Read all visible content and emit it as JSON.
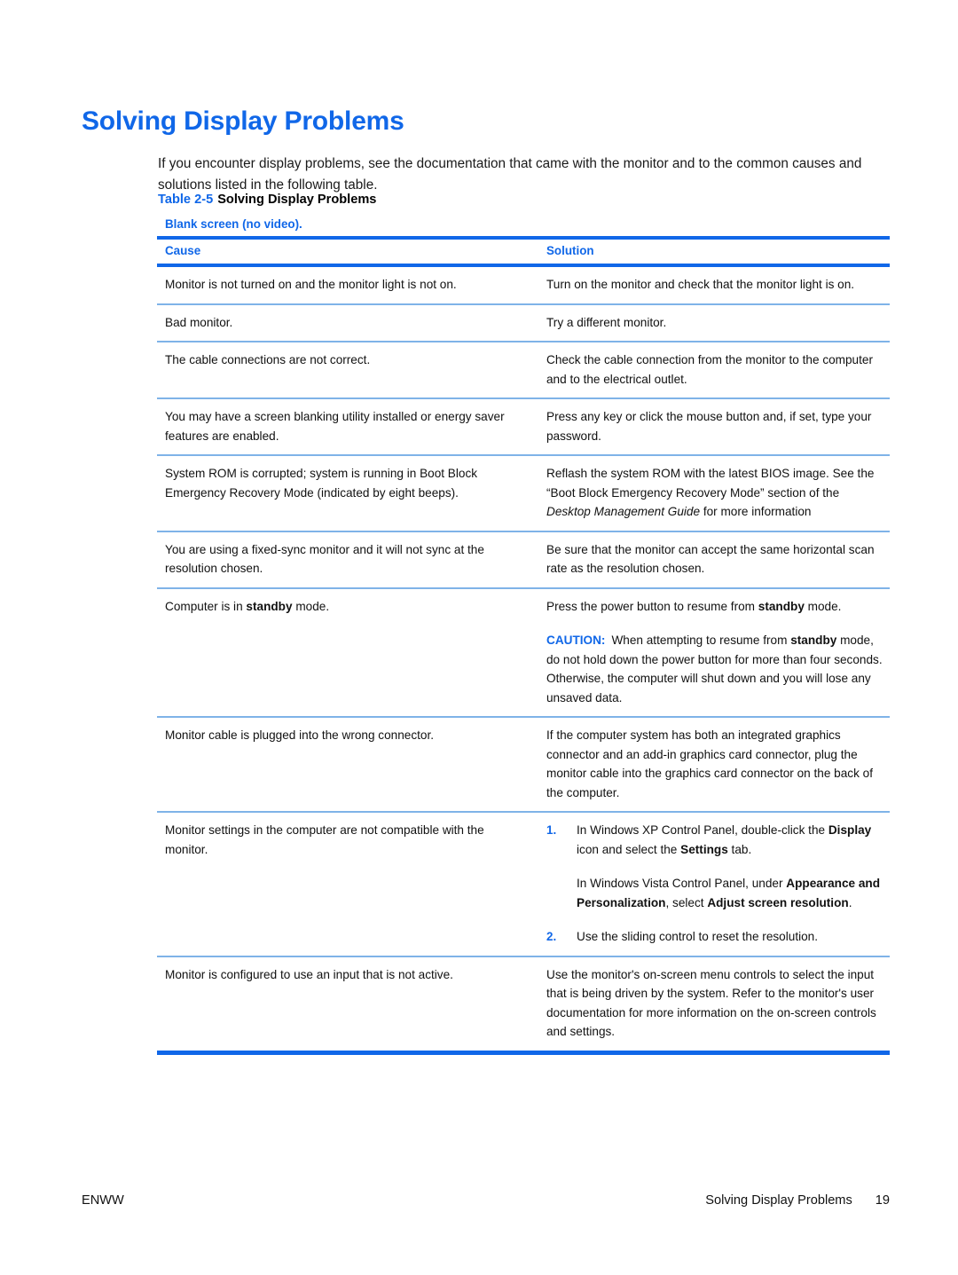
{
  "document": {
    "title": "Solving Display Problems",
    "intro": "If you encounter display problems, see the documentation that came with the monitor and to the common causes and solutions listed in the following table."
  },
  "table": {
    "caption_number": "Table 2-5",
    "caption_title": "Solving Display Problems",
    "subtitle": "Blank screen (no video).",
    "headers": {
      "cause": "Cause",
      "solution": "Solution"
    },
    "rows": [
      {
        "cause": "Monitor is not turned on and the monitor light is not on.",
        "solution": "Turn on the monitor and check that the monitor light is on."
      },
      {
        "cause": "Bad monitor.",
        "solution": "Try a different monitor."
      },
      {
        "cause": "The cable connections are not correct.",
        "solution": "Check the cable connection from the monitor to the computer and to the electrical outlet."
      },
      {
        "cause": "You may have a screen blanking utility installed or energy saver features are enabled.",
        "solution": "Press any key or click the mouse button and, if set, type your password."
      },
      {
        "cause": "System ROM is corrupted; system is running in Boot Block Emergency Recovery Mode (indicated by eight beeps).",
        "solution_part1": "Reflash the system ROM with the latest BIOS image. See the “Boot Block Emergency Recovery Mode” section of the ",
        "solution_italic": "Desktop Management Guide",
        "solution_part2": " for more information"
      },
      {
        "cause": "You are using a fixed-sync monitor and it will not sync at the resolution chosen.",
        "solution": "Be sure that the monitor can accept the same horizontal scan rate as the resolution chosen."
      },
      {
        "cause_part1": "Computer is in ",
        "cause_bold": "standby",
        "cause_part2": " mode.",
        "solution_line1_part1": "Press the power button to resume from ",
        "solution_line1_bold": "standby",
        "solution_line1_part2": " mode.",
        "caution_label": "CAUTION:",
        "caution_part1": "When attempting to resume from ",
        "caution_bold": "standby",
        "caution_part2": " mode, do not hold down the power button for more than four seconds. Otherwise, the computer will shut down and you will lose any unsaved data."
      },
      {
        "cause": "Monitor cable is plugged into the wrong connector.",
        "solution": "If the computer system has both an integrated graphics connector and an add-in graphics card connector, plug the monitor cable into the graphics card connector on the back of the computer."
      },
      {
        "cause": "Monitor settings in the computer are not compatible with the monitor.",
        "steps": [
          {
            "marker": "1.",
            "line1_part1": "In Windows XP Control Panel, double-click the ",
            "line1_bold1": "Display",
            "line1_part2": " icon and select the ",
            "line1_bold2": "Settings",
            "line1_part3": " tab.",
            "line2_part1": "In Windows Vista Control Panel, under ",
            "line2_bold1": "Appearance and Personalization",
            "line2_part2": ", select ",
            "line2_bold2": "Adjust screen resolution",
            "line2_part3": "."
          },
          {
            "marker": "2.",
            "text": "Use the sliding control to reset the resolution."
          }
        ]
      },
      {
        "cause": "Monitor is configured to use an input that is not active.",
        "solution": "Use the monitor's on-screen menu controls to select the input that is being driven by the system. Refer to the monitor's user documentation for more information on the on-screen controls and settings."
      }
    ]
  },
  "footer": {
    "left": "ENWW",
    "right_title": "Solving Display Problems",
    "page_number": "19"
  },
  "colors": {
    "accent_blue": "#1067e8",
    "rule_light_blue": "#7fb3e8",
    "text": "#111111"
  }
}
